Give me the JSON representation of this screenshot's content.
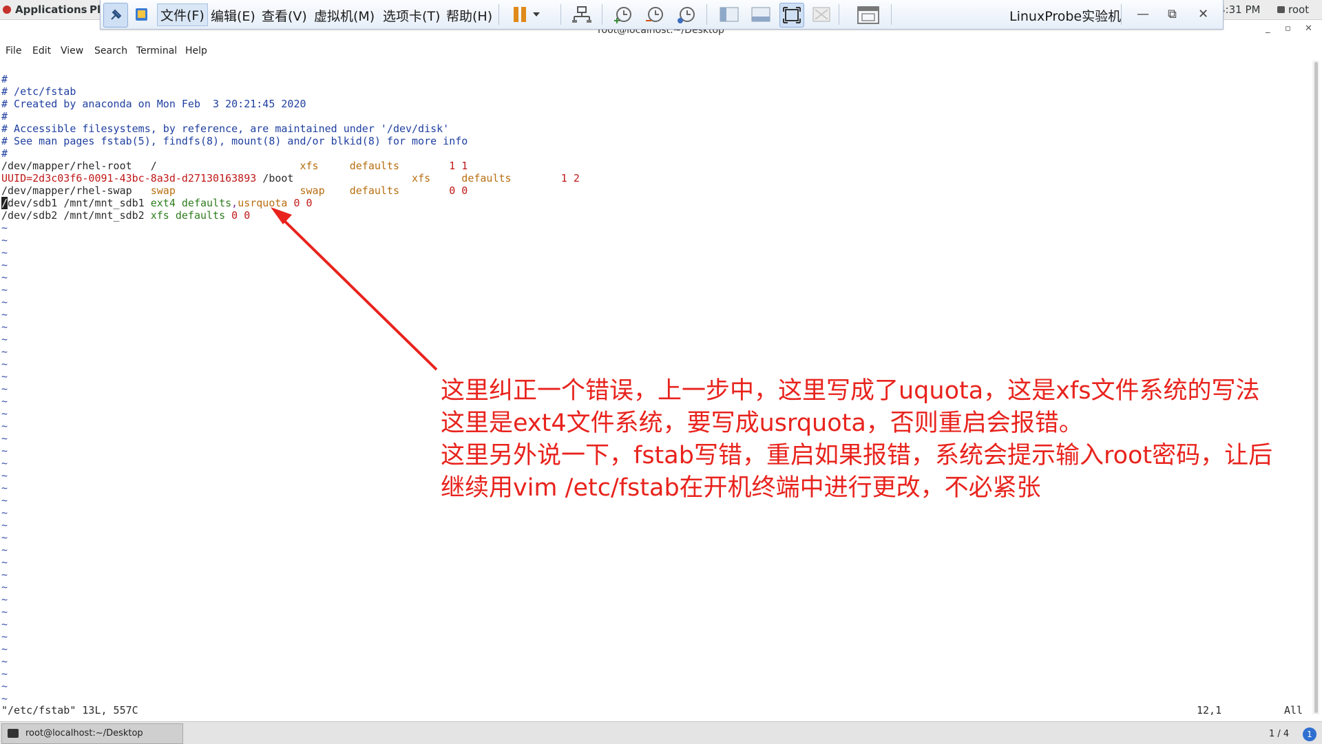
{
  "gnome_bar": {
    "applications": "Applications",
    "places": "Pl",
    "clock": "4:31 PM",
    "user": "root"
  },
  "vmware": {
    "menus": [
      "文件(F)",
      "编辑(E)",
      "查看(V)",
      "虚拟机(M)",
      "选项卡(T)",
      "帮助(H)"
    ],
    "title": "LinuxProbe实验机"
  },
  "terminal": {
    "title": "root@localhost:~/Desktop",
    "menu": [
      "File",
      "Edit",
      "View",
      "Search",
      "Terminal",
      "Help"
    ]
  },
  "vim": {
    "lines": [
      "#",
      "# /etc/fstab",
      "# Created by anaconda on Mon Feb  3 20:21:45 2020",
      "#",
      "# Accessible filesystems, by reference, are maintained under '/dev/disk'",
      "# See man pages fstab(5), findfs(8), mount(8) and/or blkid(8) for more info",
      "#"
    ],
    "entries": {
      "root": {
        "device": "/dev/mapper/rhel-root",
        "mount": "/",
        "type": "xfs",
        "options": "defaults",
        "dump": "1 1"
      },
      "boot": {
        "device": "UUID=2d3c03f6-0091-43bc-8a3d-d27130163893",
        "mount": "/boot",
        "type": "xfs",
        "options": "defaults",
        "dump": "1 2"
      },
      "swap": {
        "device": "/dev/mapper/rhel-swap",
        "mount": "swap",
        "type": "swap",
        "options": "defaults",
        "dump": "0 0"
      },
      "sdb1": {
        "cursor_char": "/",
        "device_rest": "dev/sdb1",
        "mount": "/mnt/mnt_sdb1",
        "type": "ext4",
        "options_a": "defaults",
        "options_sep": ",",
        "options_b": "usrquota",
        "dump": "0 0"
      },
      "sdb2": {
        "device": "/dev/sdb2",
        "mount": "/mnt/mnt_sdb2",
        "type": "xfs",
        "options": "defaults",
        "dump": "0 0"
      }
    },
    "tilde": "~",
    "status": "\"/etc/fstab\" 13L, 557C",
    "position": "12,1",
    "scroll": "All"
  },
  "annotation": {
    "lines": [
      "这里纠正一个错误，上一步中，这里写成了uquota，这是xfs文件系统的写法",
      "这里是ext4文件系统，要写成usrquota，否则重启会报错。",
      "这里另外说一下，fstab写错，重启如果报错，系统会提示输入root密码，让后",
      "继续用vim /etc/fstab在开机终端中进行更改，不必紧张"
    ],
    "color": "#e8231d"
  },
  "taskbar": {
    "item": "root@localhost:~/Desktop",
    "pager": "1 / 4",
    "notification": "1"
  }
}
